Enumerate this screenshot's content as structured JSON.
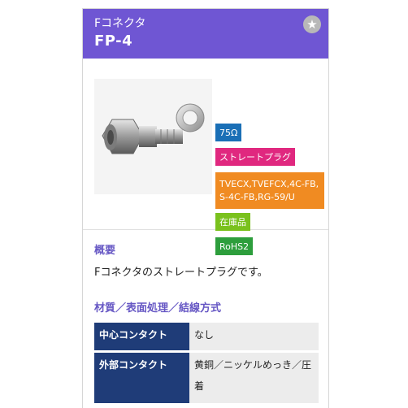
{
  "product": {
    "subtitle": "Fコネクタ",
    "title": "FP-4",
    "favorite_icon": "star-icon",
    "tags": [
      {
        "label": "75Ω",
        "color": "#1a6fb6"
      },
      {
        "label": "ストレートプラグ",
        "color": "#e0287f"
      },
      {
        "label": "TVECX,TVEFCX,4C-FB,S-4C-FB,RG-59/U",
        "color": "#f08b22"
      },
      {
        "label": "在庫品",
        "color": "#7ac11d"
      },
      {
        "label": "RoHS2",
        "color": "#2d9e3c"
      }
    ]
  },
  "overview": {
    "heading": "概要",
    "text": "Fコネクタのストレートプラグです。"
  },
  "specs": {
    "heading": "材質／表面処理／結線方式",
    "rows": [
      {
        "label": "中心コンタクト",
        "value": "なし"
      },
      {
        "label": "外部コンタクト",
        "value": "黄銅／ニッケルめっき／圧着"
      }
    ]
  },
  "colors": {
    "header_bg": "#6f56d3",
    "accent": "#6657c4",
    "table_header": "#1f3c78"
  }
}
